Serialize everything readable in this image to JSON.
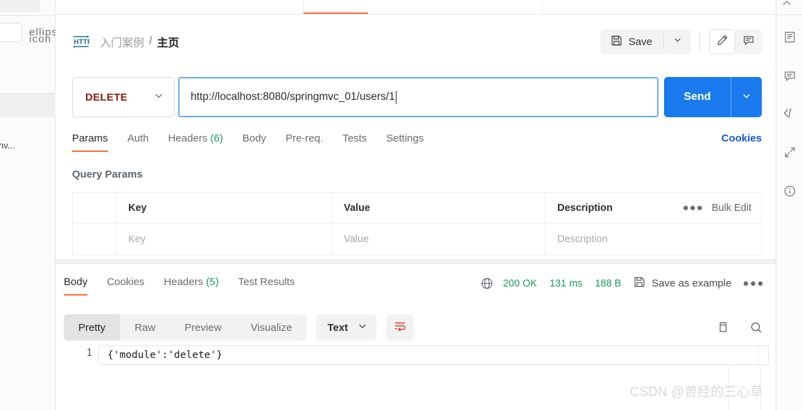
{
  "breadcrumb": {
    "icon": "http-protocol-icon",
    "parent": "入门案例",
    "separator": "/",
    "current": "主页"
  },
  "toolbar": {
    "save_label": "Save",
    "save_icon": "floppy-disk-icon",
    "save_caret_icon": "chevron-down-icon",
    "edit_icon": "pencil-icon",
    "comment_icon": "comment-icon"
  },
  "request": {
    "method": "DELETE",
    "method_caret_icon": "chevron-down-icon",
    "url": "http://localhost:8080/springmvc_01/users/1",
    "send_label": "Send",
    "send_caret_icon": "chevron-down-icon",
    "tabs": [
      {
        "label": "Params",
        "count": "",
        "active": true
      },
      {
        "label": "Auth",
        "count": "",
        "active": false
      },
      {
        "label": "Headers",
        "count": "(6)",
        "active": false
      },
      {
        "label": "Body",
        "count": "",
        "active": false
      },
      {
        "label": "Pre-req.",
        "count": "",
        "active": false
      },
      {
        "label": "Tests",
        "count": "",
        "active": false
      },
      {
        "label": "Settings",
        "count": "",
        "active": false
      }
    ],
    "cookies_link": "Cookies"
  },
  "query_params": {
    "title": "Query Params",
    "columns": [
      "Key",
      "Value",
      "Description"
    ],
    "placeholder_row": [
      "Key",
      "Value",
      "Description"
    ],
    "bulk_edit_label": "Bulk Edit",
    "more_icon": "ellipsis-icon"
  },
  "response": {
    "tabs": [
      {
        "label": "Body",
        "count": "",
        "active": true
      },
      {
        "label": "Cookies",
        "count": "",
        "active": false
      },
      {
        "label": "Headers",
        "count": "(5)",
        "active": false
      },
      {
        "label": "Test Results",
        "count": "",
        "active": false
      }
    ],
    "globe_icon": "globe-icon",
    "status": "200 OK",
    "time": "131 ms",
    "size": "188 B",
    "save_example_label": "Save as example",
    "save_example_icon": "floppy-disk-icon",
    "more_icon": "ellipsis-icon",
    "view_modes": [
      {
        "label": "Pretty",
        "active": true
      },
      {
        "label": "Raw",
        "active": false
      },
      {
        "label": "Preview",
        "active": false
      },
      {
        "label": "Visualize",
        "active": false
      }
    ],
    "format": "Text",
    "format_caret_icon": "chevron-down-icon",
    "wrap_icon": "word-wrap-icon",
    "copy_icon": "copy-icon",
    "search_icon": "search-icon",
    "line_number": "1",
    "body_text": "{'module':'delete'}"
  },
  "left_rail": {
    "more_icon": "ellipsis-icon",
    "env_label": "nv..."
  },
  "right_rail": {
    "icons": [
      "documentation-icon",
      "comment-icon",
      "code-icon",
      "expand-icon",
      "info-icon"
    ]
  },
  "tabstrip": {
    "ghost_tabs": [
      "",
      "",
      "",
      ""
    ]
  },
  "watermark": "CSDN @曾经的三心草",
  "colors": {
    "accent": "#ff6c37",
    "send_blue": "#1a7aed",
    "link_blue": "#1158d6",
    "method_red": "#8b1a10",
    "status_green": "#1a9a5f"
  }
}
